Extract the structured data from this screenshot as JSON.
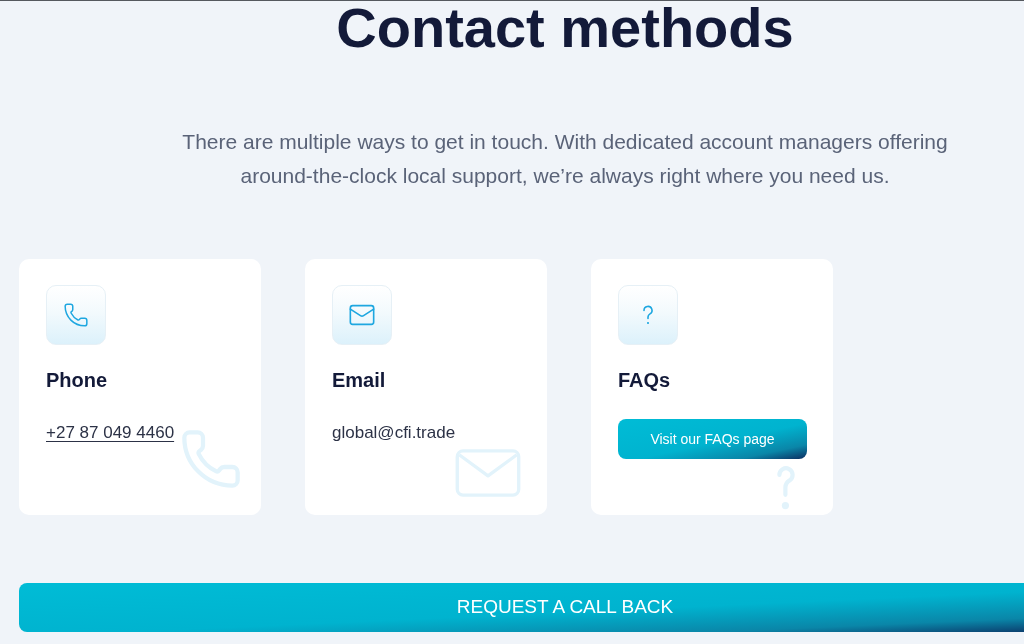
{
  "title": "Contact methods",
  "intro": "There are multiple ways to get in touch. With dedicated account managers offering around-the-clock local support, we’re always right where you need us.",
  "cards": [
    {
      "kind": "phone",
      "title": "Phone",
      "link": "+27 87 049 4460"
    },
    {
      "kind": "email",
      "title": "Email",
      "text": "global@cfi.trade"
    },
    {
      "kind": "faq",
      "title": "FAQs",
      "button": "Visit our FAQs page"
    }
  ],
  "call_back_button": "REQUEST A CALL BACK"
}
